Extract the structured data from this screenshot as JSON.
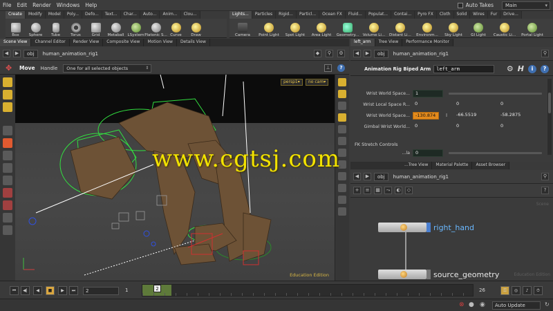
{
  "menu": {
    "items": [
      "File",
      "Edit",
      "Render",
      "Windows",
      "Help"
    ],
    "takes_label": "Auto Takes",
    "desktop": "Main"
  },
  "shelf_tabs_left": [
    "Create",
    "Modify",
    "Model",
    "Poly...",
    "Defo...",
    "Text...",
    "Char...",
    "Auto...",
    "Anim...",
    "Clou..."
  ],
  "shelf_tabs_right": [
    "Lights...",
    "Particles",
    "Rigid...",
    "Particl...",
    "Ocean FX",
    "Fluid...",
    "Populat...",
    "Contai...",
    "Pyro FX",
    "Cloth",
    "Solid",
    "Wires",
    "Fur",
    "Drive..."
  ],
  "tools_left": [
    "Box",
    "Sphere",
    "Tube",
    "Torus",
    "Grid",
    "Metaball",
    "LSystem",
    "Platonic S...",
    "Curve",
    "Draw"
  ],
  "tools_right": [
    "Camera",
    "Point Light",
    "Spot Light",
    "Area Light",
    "Geometry...",
    "Volume Li...",
    "Distant Li...",
    "Environm...",
    "Sky Light",
    "GI Light",
    "Caustic Li...",
    "Portal Light"
  ],
  "left_pane_tabs": [
    "Scene View",
    "Channel Editor",
    "Render View",
    "Composite View",
    "Motion View",
    "Details View"
  ],
  "left_path": {
    "root": "obj",
    "node": "human_animation_rig1"
  },
  "viewport_toolbar": {
    "mode": "Move",
    "handle": "Handle",
    "selection_mode": "One for all selected objects"
  },
  "viewport": {
    "camera": "persp1▾",
    "cam_menu": "no cam▾",
    "edition": "Education Edition"
  },
  "right_tabs": [
    "left_arm",
    "Tree View",
    "Performance Monitor"
  ],
  "right_path": {
    "root": "obj",
    "node": "human_animation_rig1"
  },
  "param_header": {
    "title": "Animation Rig Biped Arm",
    "name": "left_arm",
    "help": "?",
    "info": "i"
  },
  "params": {
    "rows": [
      {
        "label": "Wrist World Space...",
        "values": [
          "1"
        ]
      },
      {
        "label": "Wrist Local Space R...",
        "values": [
          "0",
          "0",
          "0"
        ]
      },
      {
        "label": "Wrist World Space...",
        "values": [
          "-130.874",
          "-66.5519",
          "-58.2875"
        ]
      },
      {
        "label": "Gimbal Wrist World...",
        "values": [
          "0",
          "0",
          "0"
        ]
      }
    ],
    "section_fk": "FK Stretch Controls",
    "fk_label": "...la",
    "fk_value": "0"
  },
  "network_tabs": [
    "...Tree View",
    "Material Palette",
    "Asset Browser"
  ],
  "network_path": {
    "root": "obj",
    "node": "human_animation_rig1"
  },
  "network": {
    "bg_label": "Scene",
    "bg_label2": "Education Edition",
    "nodes": [
      "right_hand",
      "source_geometry"
    ]
  },
  "timeline": {
    "start": "2",
    "step": "1",
    "current": "2",
    "end": "26"
  },
  "status": {
    "auto_update": "Auto Update"
  },
  "watermark": "www.cgtsj.com",
  "colors": {
    "highlight_field": "#e38a1c",
    "edu_text": "#d9b844",
    "node_label": "#6ab8ff",
    "watermark": "#f2e200"
  }
}
